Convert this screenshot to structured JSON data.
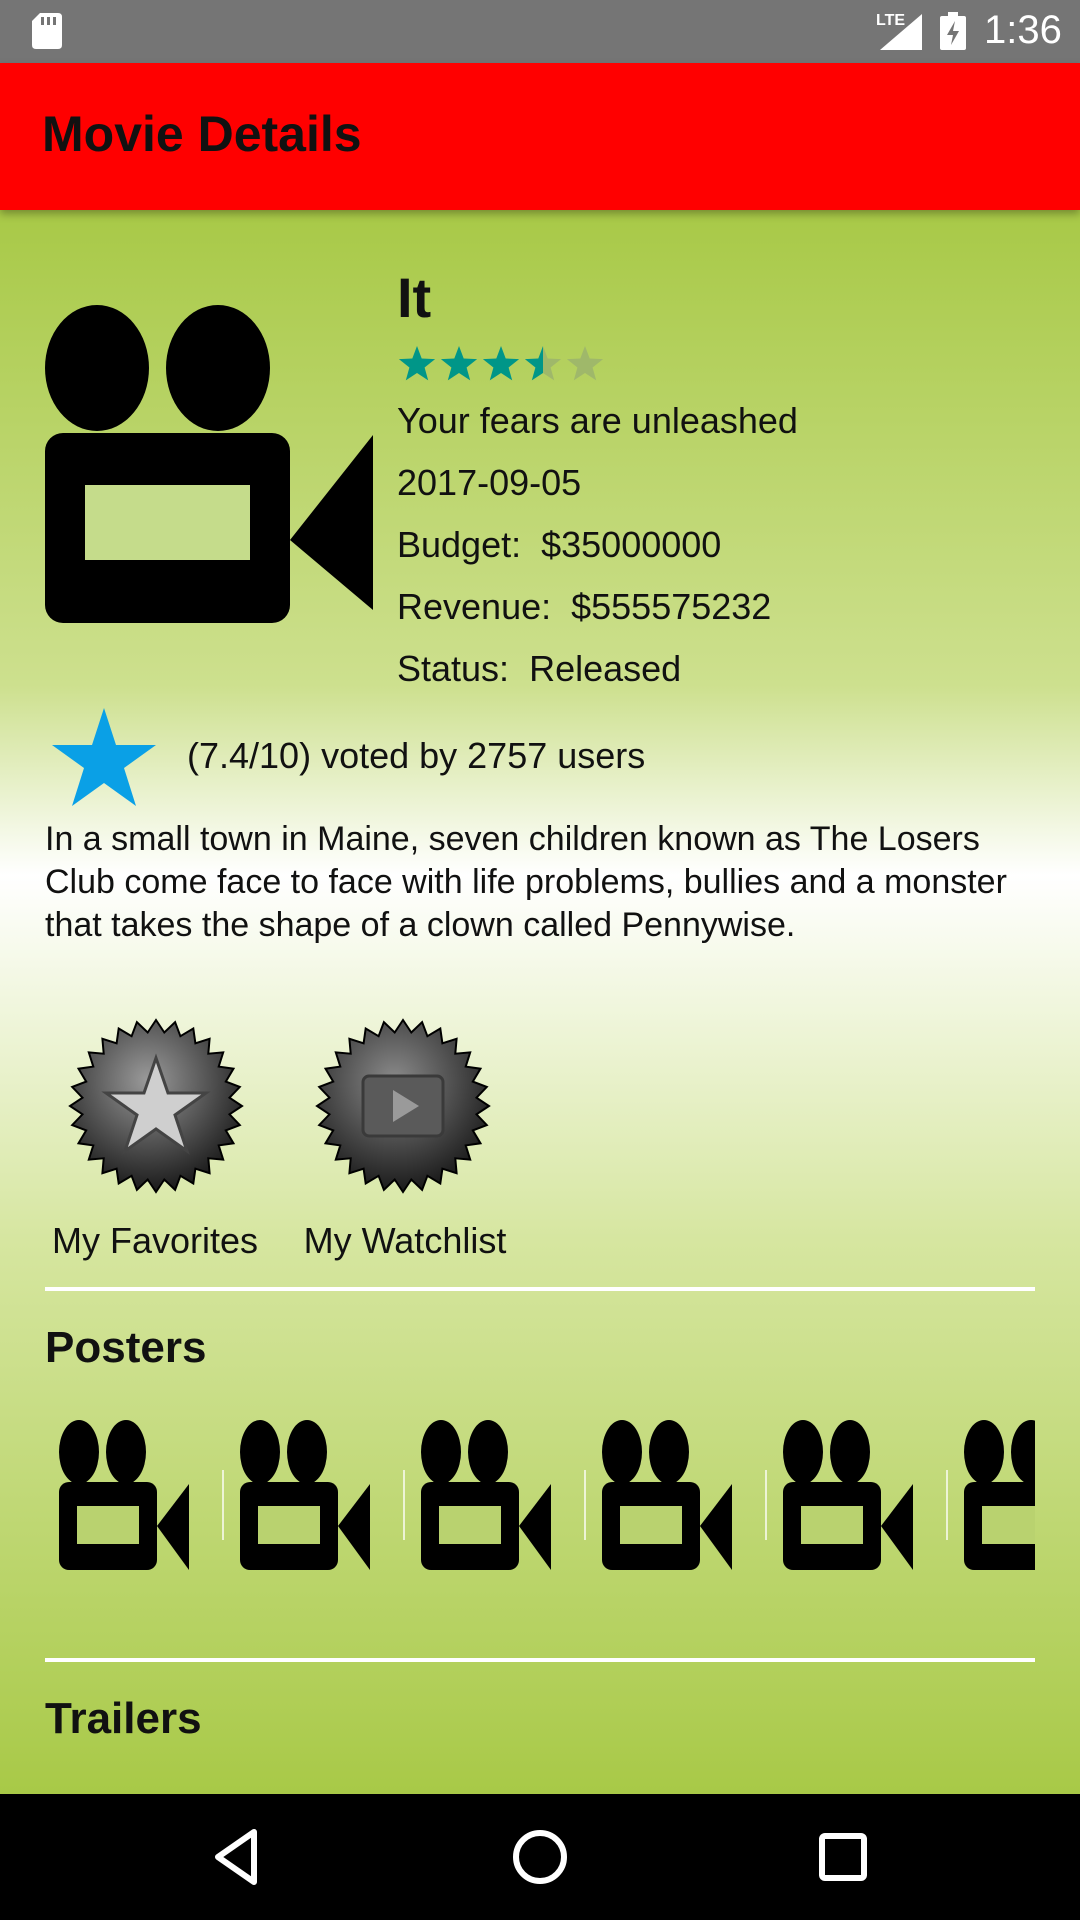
{
  "status_bar": {
    "time": "1:36",
    "network": "LTE"
  },
  "app_bar": {
    "title": "Movie Details"
  },
  "movie": {
    "title": "It",
    "rating_stars": 3.5,
    "rating_stars_max": 5,
    "tagline": "Your fears are unleashed",
    "release_date": "2017-09-05",
    "budget": "Budget:  $35000000",
    "revenue": "Revenue:  $555575232",
    "status": "Status:  Released",
    "vote_text": "(7.4/10) voted by 2757 users",
    "overview": "In a small town in Maine, seven children known as The Losers Club come face to face with life problems, bullies and a monster that takes the shape of a clown called Pennywise."
  },
  "actions": {
    "favorites_label": "My Favorites",
    "watchlist_label": "My Watchlist"
  },
  "sections": {
    "posters_title": "Posters",
    "trailers_title": "Trailers"
  },
  "posters": [
    {
      "icon": "movie-camera-icon"
    },
    {
      "icon": "movie-camera-icon"
    },
    {
      "icon": "movie-camera-icon"
    },
    {
      "icon": "movie-camera-icon"
    },
    {
      "icon": "movie-camera-icon"
    },
    {
      "icon": "movie-camera-icon"
    }
  ],
  "colors": {
    "app_bar": "#ff0000",
    "status_bar": "#757575",
    "rating_star": "#009688",
    "vote_star": "#0aa0e6"
  }
}
